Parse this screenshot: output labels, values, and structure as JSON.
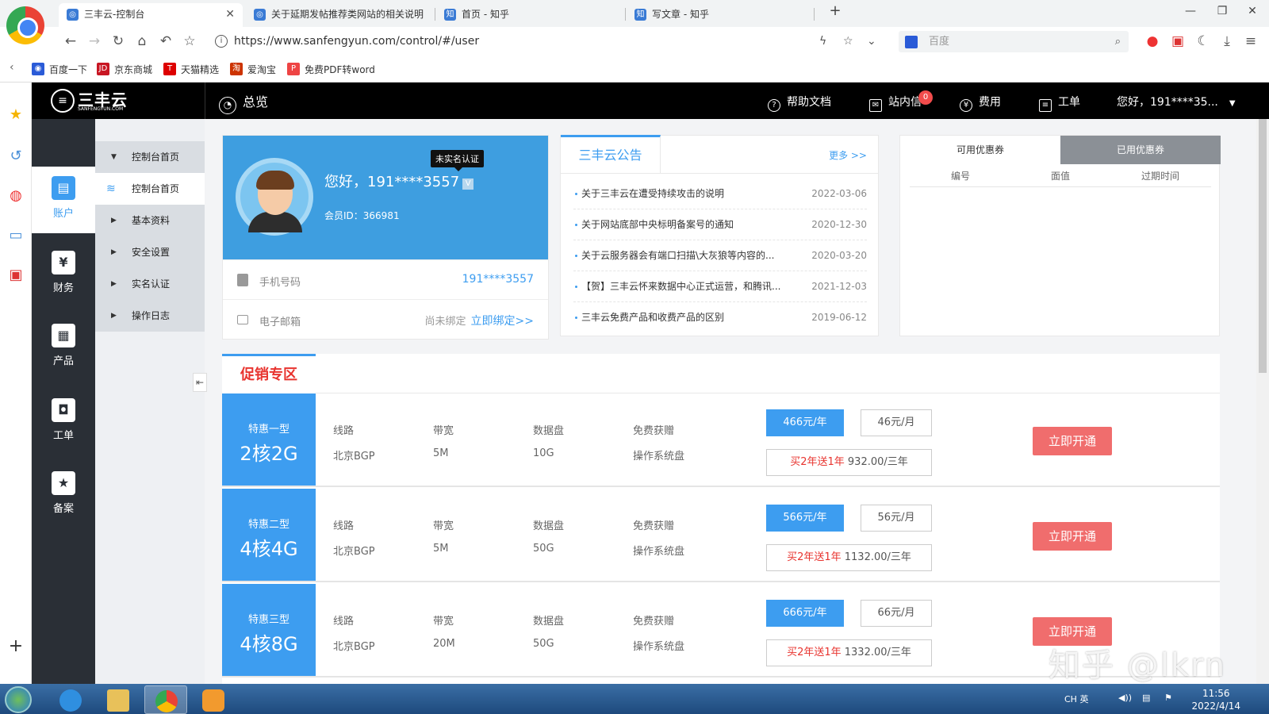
{
  "browser": {
    "tabs": [
      {
        "label": "三丰云-控制台",
        "active": true
      },
      {
        "label": "关于延期发帖推荐类网站的相关说明"
      },
      {
        "label": "首页 - 知乎"
      },
      {
        "label": "写文章 - 知乎"
      }
    ],
    "url": "https://www.sanfengyun.com/control/#/user",
    "search_placeholder": "百度",
    "bookmarks": [
      "百度一下",
      "京东商城",
      "天猫精选",
      "爱淘宝",
      "免费PDF转word"
    ]
  },
  "header": {
    "logo": "三丰云",
    "logo_sub": "SANFENGYUN.COM",
    "overview": "总览",
    "help": "帮助文档",
    "messages": "站内信",
    "message_count": "0",
    "billing": "费用",
    "tickets": "工单",
    "user_greeting": "您好，191****35..."
  },
  "sidebar": [
    {
      "label": "账户",
      "icon": "account-icon",
      "active": true
    },
    {
      "label": "财务",
      "icon": "finance-icon"
    },
    {
      "label": "产品",
      "icon": "product-icon"
    },
    {
      "label": "工单",
      "icon": "ticket-icon"
    },
    {
      "label": "备案",
      "icon": "record-icon"
    }
  ],
  "submenu": [
    {
      "label": "控制台首页",
      "header": true
    },
    {
      "label": "控制台首页",
      "selected": true
    },
    {
      "label": "基本资料"
    },
    {
      "label": "安全设置"
    },
    {
      "label": "实名认证"
    },
    {
      "label": "操作日志"
    }
  ],
  "user_card": {
    "tooltip": "未实名认证",
    "greeting": "您好，191****3557",
    "v_mark": "V",
    "member_id": "会员ID：366981",
    "phone_label": "手机号码",
    "phone_value": "191****3557",
    "email_label": "电子邮箱",
    "email_status": "尚未绑定",
    "email_bind": "立即绑定>>"
  },
  "notice": {
    "title": "三丰云公告",
    "more": "更多 >>",
    "items": [
      {
        "text": "关于三丰云在遭受持续攻击的说明",
        "date": "2022-03-06"
      },
      {
        "text": "关于网站底部中央标明备案号的通知",
        "date": "2020-12-30"
      },
      {
        "text": "关于云服务器会有端口扫描\\大灰狼等内容的...",
        "date": "2020-03-20"
      },
      {
        "text": "【贺】三丰云怀来数据中心正式运营，和腾讯...",
        "date": "2021-12-03"
      },
      {
        "text": "三丰云免费产品和收费产品的区别",
        "date": "2019-06-12"
      }
    ]
  },
  "coupons": {
    "tab_available": "可用优惠券",
    "tab_used": "已用优惠券",
    "columns": [
      "编号",
      "面值",
      "过期时间"
    ]
  },
  "promo": {
    "title": "促销专区",
    "spec_labels": [
      "线路",
      "带宽",
      "数据盘",
      "免费获赠"
    ],
    "buy_label": "立即开通",
    "plans": [
      {
        "name": "特惠一型",
        "spec": "2核2G",
        "line": "北京BGP",
        "bandwidth": "5M",
        "disk": "10G",
        "gift": "操作系统盘",
        "year": "466元/年",
        "month": "46元/月",
        "three_red": "买2年送1年",
        "three_price": "932.00/三年"
      },
      {
        "name": "特惠二型",
        "spec": "4核4G",
        "line": "北京BGP",
        "bandwidth": "5M",
        "disk": "50G",
        "gift": "操作系统盘",
        "year": "566元/年",
        "month": "56元/月",
        "three_red": "买2年送1年",
        "three_price": "1132.00/三年"
      },
      {
        "name": "特惠三型",
        "spec": "4核8G",
        "line": "北京BGP",
        "bandwidth": "20M",
        "disk": "50G",
        "gift": "操作系统盘",
        "year": "666元/年",
        "month": "66元/月",
        "three_red": "买2年送1年",
        "three_price": "1332.00/三年"
      }
    ]
  },
  "watermark": "知乎 @lkrn",
  "taskbar": {
    "tray": "CH 英",
    "time": "11:56",
    "date": "2022/4/14"
  }
}
